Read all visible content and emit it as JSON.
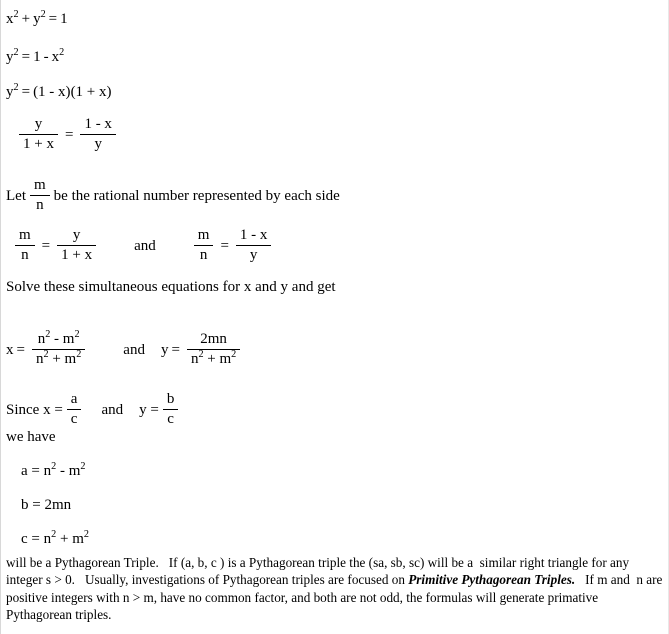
{
  "document": {
    "type": "math-derivation",
    "background_color": "#ffffff",
    "text_color": "#000000",
    "equations": [
      {
        "id": "eq-circle",
        "text": "x2 + y2 = 1",
        "lhs_base": "x",
        "lhs_exp": "2",
        "plus": "+",
        "rhs_base": "y",
        "rhs_exp": "2",
        "equals": "=",
        "result": "1"
      },
      {
        "id": "eq-solve-y2",
        "text": "y2 = 1 - x2",
        "lhs_base": "y",
        "lhs_exp": "2",
        "equals": "=",
        "one": "1",
        "minus": "-",
        "rhs_base": "x",
        "rhs_exp": "2"
      },
      {
        "id": "eq-factored",
        "text": "y2 = (1 - x)(1 + x)",
        "lhs_base": "y",
        "lhs_exp": "2",
        "equals": "=",
        "factor1": "(1 - x)",
        "factor2": "(1 + x)"
      }
    ],
    "fraction_equation": {
      "id": "eq-cross-ratio",
      "left_num": "y",
      "left_den": "1 + x",
      "equals": "=",
      "right_num": "1 - x",
      "right_den": "y"
    },
    "let_line": {
      "prefix": "Let",
      "frac_num": "m",
      "frac_den": "n",
      "suffix": "be the rational number represented by each side"
    },
    "simultaneous": {
      "first": {
        "left_num": "m",
        "left_den": "n",
        "equals": "=",
        "right_num": "y",
        "right_den": "1 + x"
      },
      "conjunction": "and",
      "second": {
        "left_num": "m",
        "left_den": "n",
        "equals": "=",
        "right_num": "1 - x",
        "right_den": "y"
      }
    },
    "solve_instruction": "Solve these simultaneous equations for x and y and get",
    "solutions": {
      "x": {
        "label": "x",
        "equals": "=",
        "num_base1": "n",
        "num_exp1": "2",
        "num_op": "-",
        "num_base2": "m",
        "num_exp2": "2",
        "den_base1": "n",
        "den_exp1": "2",
        "den_op": "+",
        "den_base2": "m",
        "den_exp2": "2"
      },
      "conjunction": "and",
      "y": {
        "label": "y",
        "equals": "=",
        "num": "2mn",
        "den_base1": "n",
        "den_exp1": "2",
        "den_op": "+",
        "den_base2": "m",
        "den_exp2": "2"
      }
    },
    "since_line": {
      "prefix": "Since x =",
      "first_num": "a",
      "first_den": "c",
      "conjunction": "and",
      "y_label": "y =",
      "second_num": "b",
      "second_den": "c"
    },
    "we_have": "we have",
    "triple_formulas": [
      {
        "id": "formula-a",
        "lhs": "a =",
        "base1": "n",
        "exp1": "2",
        "op": "-",
        "base2": "m",
        "exp2": "2"
      },
      {
        "id": "formula-b",
        "lhs": "b =",
        "plain": "2mn"
      },
      {
        "id": "formula-c",
        "lhs": "c =",
        "base1": "n",
        "exp1": "2",
        "op": "+",
        "base2": "m",
        "exp2": "2"
      }
    ],
    "closing_paragraph": {
      "part1": "will be a Pythagorean Triple.",
      "part2": "If (a, b, c ) is a Pythagorean triple the (sa, sb, sc) will be a  similar right triangle for any integer s > 0.",
      "part3": "Usually, investigations of Pythagorean triples are focused on ",
      "emphasis": "Primitive Pythagorean Triples.",
      "part4": "If m and  n are positive integers with n > m, have no common factor, and both are not odd, the formulas will generate primative Pythagorean triples."
    }
  }
}
